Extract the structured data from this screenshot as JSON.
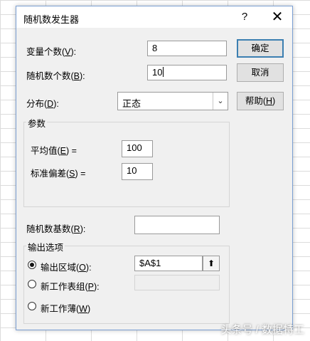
{
  "dialog": {
    "title": "随机数发生器",
    "help_symbol": "?",
    "close_symbol": "✕"
  },
  "fields": {
    "num_variables": {
      "label": "变量个数(",
      "accel": "V",
      "suffix": "):",
      "value": "8"
    },
    "num_random": {
      "label": "随机数个数(",
      "accel": "B",
      "suffix": "):",
      "value": "10"
    },
    "distribution": {
      "label": "分布(",
      "accel": "D",
      "suffix": "):",
      "value": "正态"
    }
  },
  "buttons": {
    "ok": "确定",
    "cancel": "取消",
    "help_label": "帮助(",
    "help_accel": "H",
    "help_suffix": ")"
  },
  "parameters": {
    "title": "参数",
    "mean": {
      "label": "平均值(",
      "accel": "E",
      "suffix": ") =",
      "value": "100"
    },
    "stddev": {
      "label": "标准偏差(",
      "accel": "S",
      "suffix": ") =",
      "value": "10"
    }
  },
  "seed": {
    "label": "随机数基数(",
    "accel": "R",
    "suffix": "):",
    "value": ""
  },
  "output": {
    "title": "输出选项",
    "range": {
      "label": "输出区域(",
      "accel": "O",
      "suffix": "):",
      "value": "$A$1",
      "checked": true
    },
    "new_sheet": {
      "label": "新工作表组(",
      "accel": "P",
      "suffix": "):",
      "checked": false
    },
    "new_workbook": {
      "label": "新工作薄(",
      "accel": "W",
      "suffix": ")",
      "checked": false
    },
    "ref_icon": "⬆"
  },
  "watermark": "头条号 / 数据特工"
}
